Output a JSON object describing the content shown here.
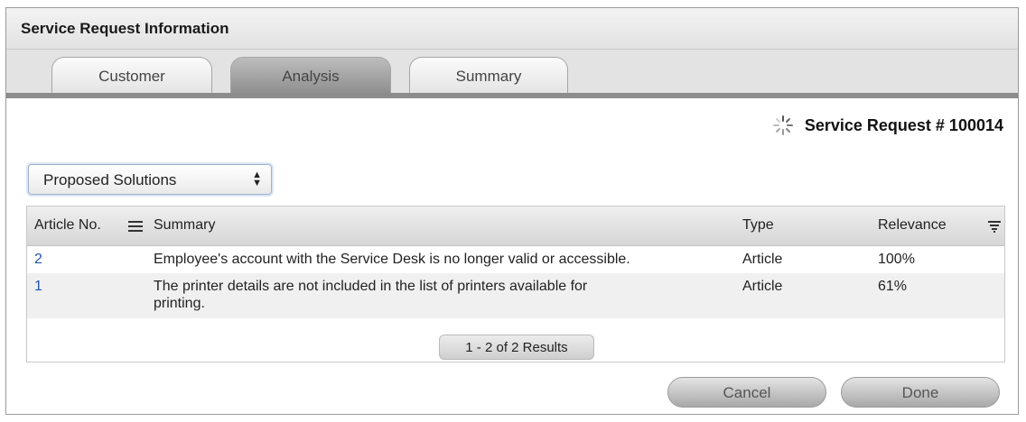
{
  "window": {
    "title": "Service Request Information"
  },
  "tabs": [
    {
      "label": "Customer",
      "active": false
    },
    {
      "label": "Analysis",
      "active": true
    },
    {
      "label": "Summary",
      "active": false
    }
  ],
  "service_request": {
    "label": "Service Request # 100014",
    "icon": "spinner-icon"
  },
  "view_select": {
    "selected": "Proposed Solutions"
  },
  "table": {
    "columns": [
      "Article No.",
      "Summary",
      "Type",
      "Relevance"
    ],
    "rows": [
      {
        "article_no": "2",
        "summary": "Employee's account with the Service Desk is no longer valid or accessible.",
        "type": "Article",
        "relevance": "100%"
      },
      {
        "article_no": "1",
        "summary_line1": "The printer details are not included in the list of printers available for",
        "summary_line2": "printing.",
        "type": "Article",
        "relevance": "61%"
      }
    ],
    "pager": "1 - 2 of 2 Results"
  },
  "buttons": {
    "cancel": "Cancel",
    "done": "Done"
  },
  "colors": {
    "link": "#2255aa",
    "active_tab": "#9a9a9a",
    "tab_strip_border": "#8c8c8c"
  }
}
